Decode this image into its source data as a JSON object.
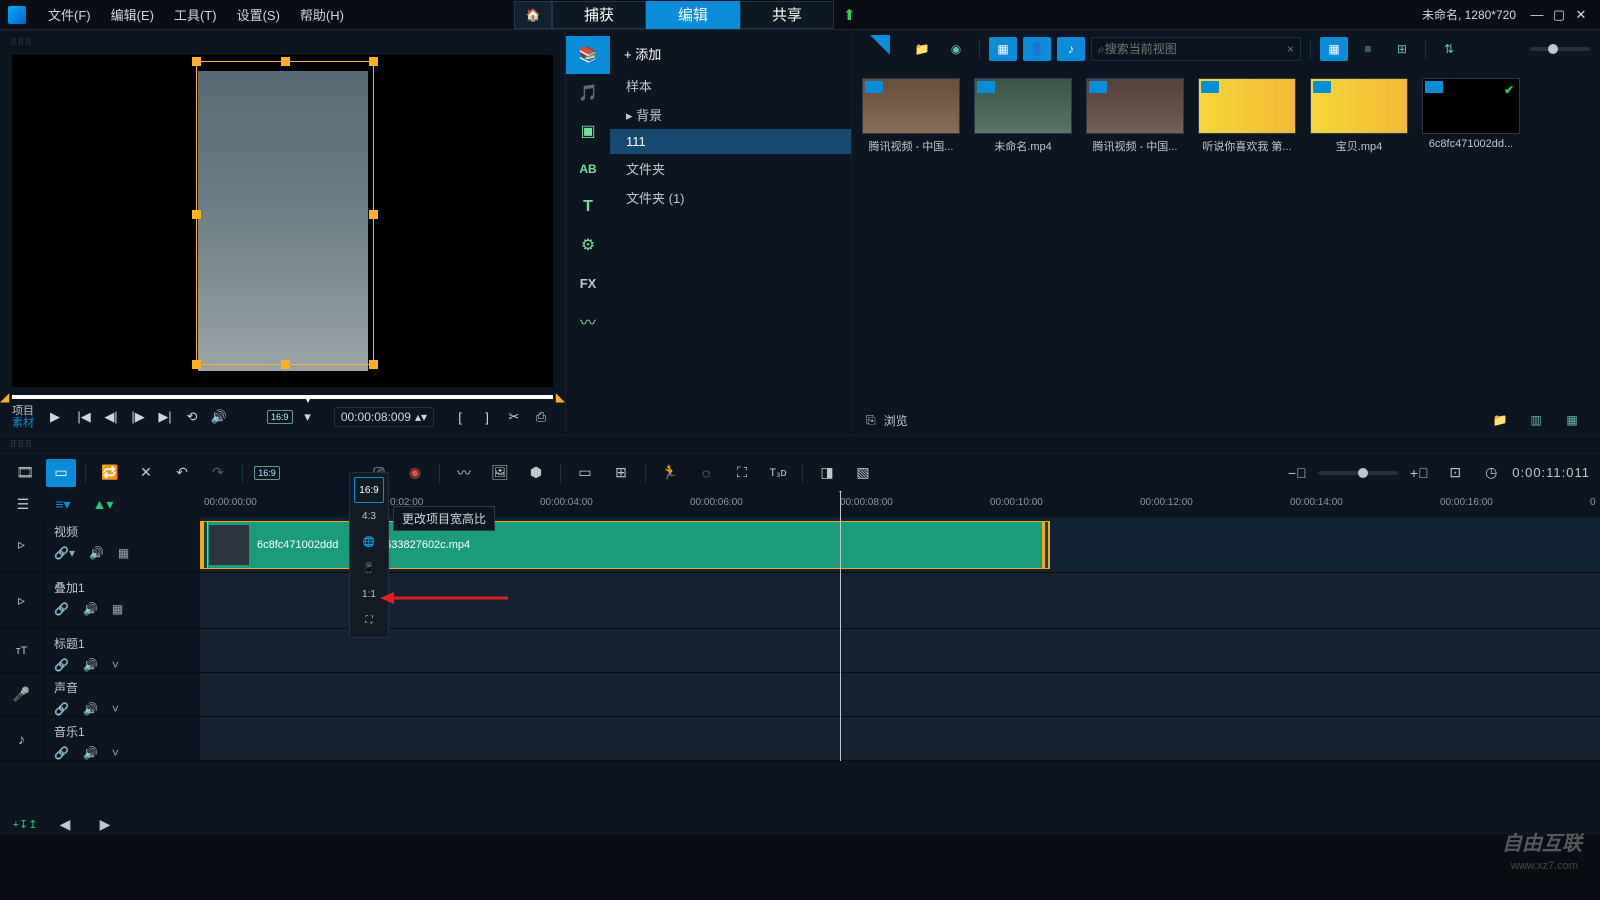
{
  "menubar": {
    "file": "文件(F)",
    "edit": "编辑(E)",
    "tools": "工具(T)",
    "settings": "设置(S)",
    "help": "帮助(H)"
  },
  "main_tabs": {
    "capture": "捕获",
    "edit": "编辑",
    "share": "共享"
  },
  "project_info": "未命名, 1280*720",
  "transport": {
    "project_lbl": "项目",
    "clip_lbl": "素材",
    "aspect": "16:9",
    "timecode": "00:00:08:009"
  },
  "library": {
    "add": "+  添加",
    "tree": {
      "sample": "样本",
      "background": "▸ 背景",
      "folder111": "111",
      "folder1": "文件夹",
      "folder2": "文件夹 (1)"
    },
    "search_placeholder": "搜索当前视图",
    "browse": "浏览",
    "thumbs": [
      {
        "label": "腾讯视频 - 中国..."
      },
      {
        "label": "未命名.mp4"
      },
      {
        "label": "腾讯视频 - 中国..."
      },
      {
        "label": "听说你喜欢我 第..."
      },
      {
        "label": "宝贝.mp4"
      },
      {
        "label": "6c8fc471002dd..."
      }
    ]
  },
  "aspect_dd": {
    "tooltip": "更改项目宽高比",
    "o16_9": "16:9",
    "o4_3": "4:3",
    "o1_1": "1:1"
  },
  "timeline_toolbar": {
    "tc": "0:00:11:011"
  },
  "ruler": {
    "t0": "00:00:00:00",
    "t2": "0:02:00",
    "t4": "00:00:04:00",
    "t6": "00:00:06:00",
    "t8": "00:00:08:00",
    "t10": "00:00:10:00",
    "t12": "00:00:12:00",
    "t14": "00:00:14:00",
    "t16": "00:00:16:00",
    "t18": "0"
  },
  "tracks": {
    "video": "视频",
    "overlay": "叠加1",
    "title": "标题1",
    "voice": "声音",
    "music": "音乐1",
    "clip1": "6c8fc471002ddd",
    "clip2": "5633827602c.mp4"
  },
  "watermark": {
    "brand": "自由互联",
    "url": "www.xz7.com"
  }
}
